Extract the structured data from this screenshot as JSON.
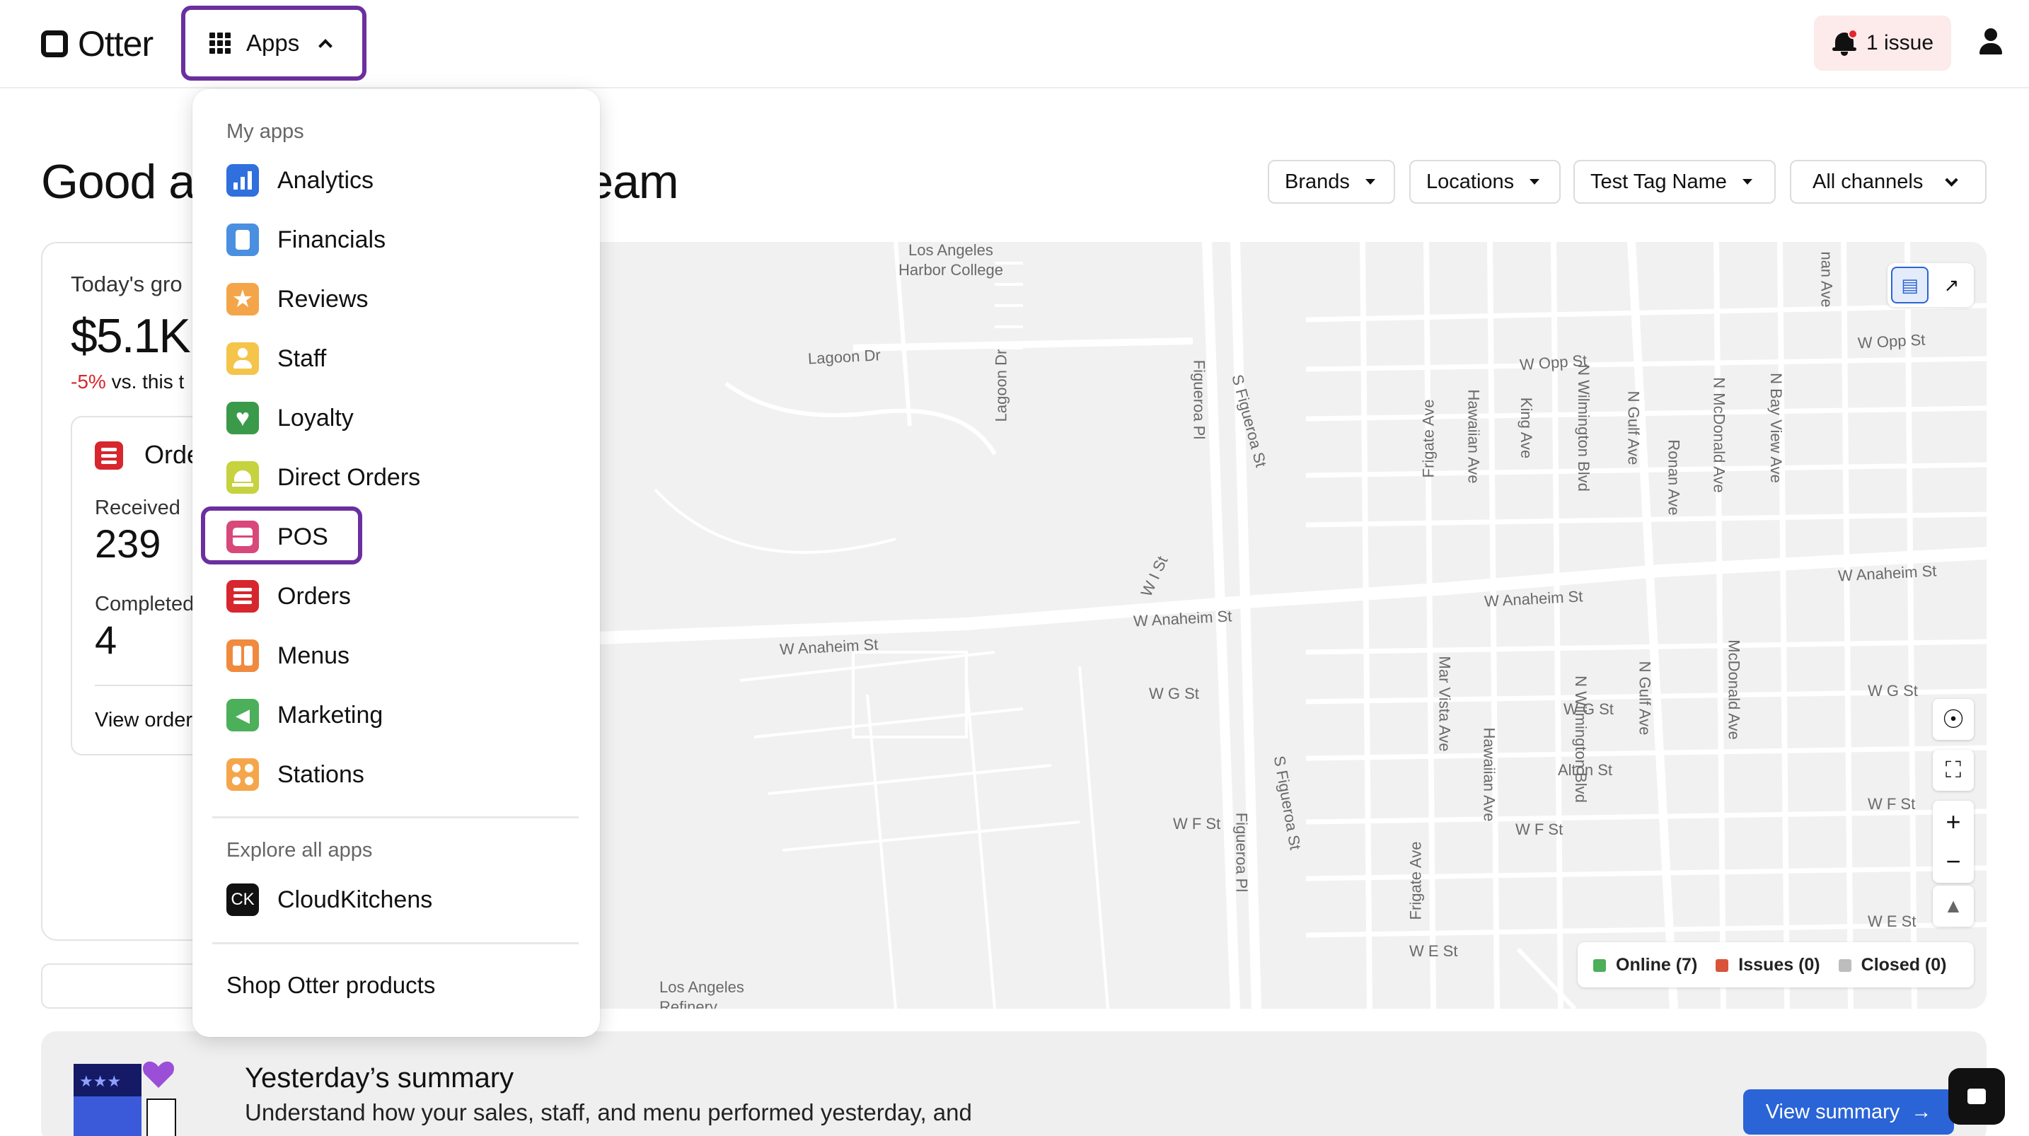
{
  "header": {
    "logo_text": "Otter",
    "apps_label": "Apps",
    "issue_label": "1 issue"
  },
  "greeting": {
    "left": "Good a",
    "right": "ning Team"
  },
  "filters": [
    "Brands",
    "Locations",
    "Test Tag Name",
    "All channels"
  ],
  "sales": {
    "title": "Today's gro",
    "value": "$5.1K",
    "delta": "-5%",
    "delta_suffix": " vs. this t",
    "orders": {
      "title": "Orde",
      "received_label": "Received",
      "received_value": "239",
      "completed_label": "Completed",
      "completed_value": "4",
      "view_link": "View order"
    }
  },
  "dropdown": {
    "my_apps_heading": "My apps",
    "apps": [
      {
        "label": "Analytics",
        "icon": "analytics-icon",
        "color": "#2f6fde"
      },
      {
        "label": "Financials",
        "icon": "financials-icon",
        "color": "#4a8fe0"
      },
      {
        "label": "Reviews",
        "icon": "reviews-star-icon",
        "color": "#f4a54a"
      },
      {
        "label": "Staff",
        "icon": "staff-person-icon",
        "color": "#f4c54a"
      },
      {
        "label": "Loyalty",
        "icon": "loyalty-heart-icon",
        "color": "#3a9a4a"
      },
      {
        "label": "Direct Orders",
        "icon": "direct-orders-bell-icon",
        "color": "#c6d23e"
      },
      {
        "label": "POS",
        "icon": "pos-icon",
        "color": "#d9487a"
      },
      {
        "label": "Orders",
        "icon": "orders-icon",
        "color": "#d7262d"
      },
      {
        "label": "Menus",
        "icon": "menus-icon",
        "color": "#f08a3e"
      },
      {
        "label": "Marketing",
        "icon": "marketing-icon",
        "color": "#4caf5a"
      },
      {
        "label": "Stations",
        "icon": "stations-icon",
        "color": "#f5a64a"
      }
    ],
    "explore_heading": "Explore all apps",
    "explore_apps": [
      {
        "label": "CloudKitchens",
        "icon_text": "CK"
      }
    ],
    "shop_label": "Shop Otter products"
  },
  "map": {
    "labels": [
      "Los Angeles\nHarbor College",
      "Lagoon Dr",
      "Lagoon Dr",
      "Figueroa Pl",
      "S Figueroa St",
      "W Opp St",
      "W Opp St",
      "Frigate Ave",
      "Hawaiian Ave",
      "King Ave",
      "N Wilmington Blvd",
      "N Gulf Ave",
      "Ronan Ave",
      "N McDonald Ave",
      "N Bay View Ave",
      "W Anaheim St",
      "W Anaheim St",
      "W Anaheim St",
      "W Anaheim St",
      "W I St",
      "W G St",
      "W G St",
      "W G St",
      "Alton St",
      "W F St",
      "W F St",
      "W F St",
      "W E St",
      "W E St",
      "Mar Vista Ave",
      "Figueroa Pl",
      "S Figueroa St",
      "Frigate Ave",
      "Hawaiian Ave",
      "N Wilmington Blvd",
      "N Gulf Ave",
      "McDonald Ave",
      "Los Angeles\nRefinery",
      "nan Ave"
    ],
    "legend": [
      {
        "label": "Online (7)",
        "color": "#4caf5a"
      },
      {
        "label": "Issues (0)",
        "color": "#d9533a"
      },
      {
        "label": "Closed (0)",
        "color": "#bdbdbd"
      }
    ],
    "controls": [
      "locate-icon",
      "fullscreen-icon",
      "zoom-in-icon",
      "zoom-out-icon",
      "compass-icon"
    ],
    "view_toggle": [
      "map-view-icon",
      "chart-view-icon"
    ]
  },
  "summary": {
    "title": "Yesterday’s summary",
    "description": "Understand how your sales, staff, and menu performed yesterday, and",
    "button_label": "View summary"
  },
  "colors": {
    "accent_purple": "#6b2fa0",
    "primary_blue": "#2a64d6",
    "issue_bg": "#fcebea",
    "negative_red": "#d7262d"
  }
}
